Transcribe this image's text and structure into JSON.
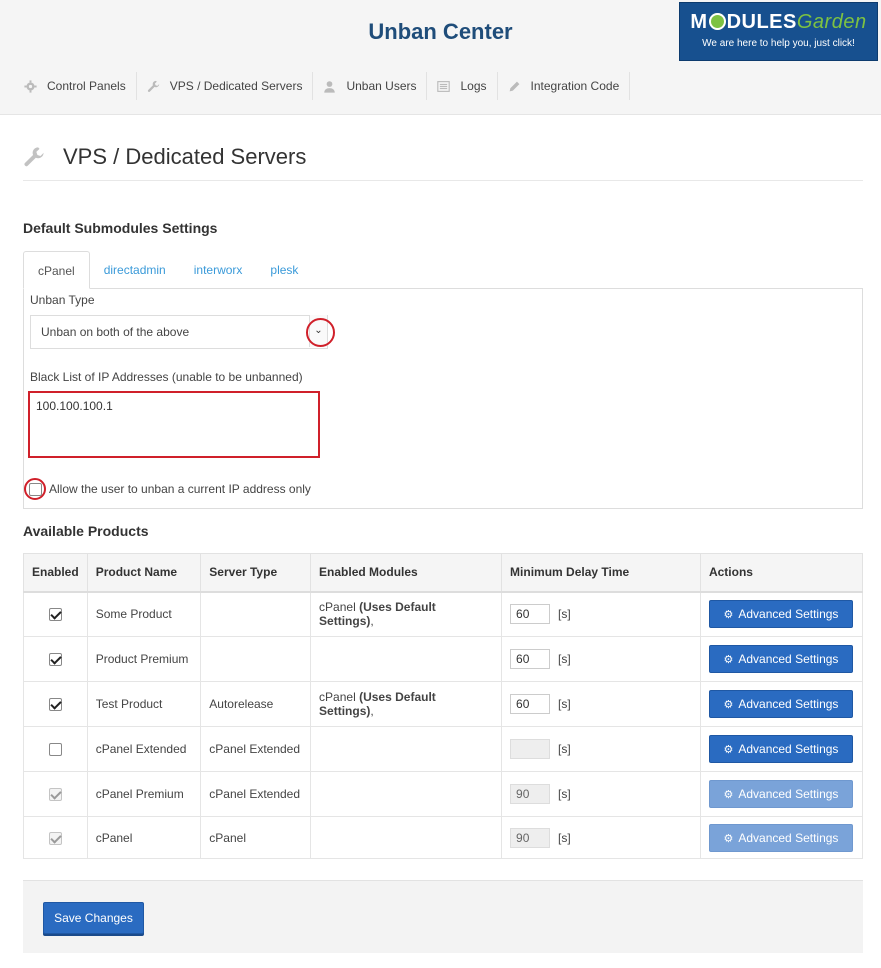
{
  "header": {
    "app_title": "Unban Center",
    "brand_name": "MODULES Garden",
    "brand_tagline": "We are here to help you, just click!"
  },
  "nav": [
    {
      "label": "Control Panels",
      "icon": "gear-icon"
    },
    {
      "label": "VPS / Dedicated Servers",
      "icon": "wrench-icon"
    },
    {
      "label": "Unban Users",
      "icon": "user-icon"
    },
    {
      "label": "Logs",
      "icon": "list-icon"
    },
    {
      "label": "Integration Code",
      "icon": "pencil-icon"
    }
  ],
  "page": {
    "title": "VPS / Dedicated Servers"
  },
  "defaults": {
    "section_title": "Default Submodules Settings",
    "tabs": [
      "cPanel",
      "directadmin",
      "interworx",
      "plesk"
    ],
    "active_tab": "cPanel",
    "unban_type_label": "Unban Type",
    "unban_type_value": "Unban on both of the above",
    "blacklist_label": "Black List of IP Addresses (unable to be unbanned)",
    "blacklist_value": "100.100.100.1",
    "allow_current_ip_label": "Allow the user to unban a current IP address only",
    "allow_current_ip_checked": false
  },
  "products": {
    "section_title": "Available Products",
    "columns": [
      "Enabled",
      "Product Name",
      "Server Type",
      "Enabled Modules",
      "Minimum Delay Time",
      "Actions"
    ],
    "unit": "[s]",
    "action_label": "Advanced Settings",
    "rows": [
      {
        "enabled": true,
        "disabled": false,
        "name": "Some Product",
        "server_type": "",
        "module": "cPanel",
        "module_note": "(Uses Default Settings)",
        "module_suffix": ",",
        "delay": "60"
      },
      {
        "enabled": true,
        "disabled": false,
        "name": "Product Premium",
        "server_type": "",
        "module": "",
        "module_note": "",
        "module_suffix": "",
        "delay": "60"
      },
      {
        "enabled": true,
        "disabled": false,
        "name": "Test Product",
        "server_type": "Autorelease",
        "module": "cPanel",
        "module_note": "(Uses Default Settings)",
        "module_suffix": ",",
        "delay": "60"
      },
      {
        "enabled": false,
        "disabled": false,
        "name": "cPanel Extended",
        "server_type": "cPanel Extended",
        "module": "",
        "module_note": "",
        "module_suffix": "",
        "delay": ""
      },
      {
        "enabled": true,
        "disabled": true,
        "name": "cPanel Premium",
        "server_type": "cPanel Extended",
        "module": "",
        "module_note": "",
        "module_suffix": "",
        "delay": "90"
      },
      {
        "enabled": true,
        "disabled": true,
        "name": "cPanel",
        "server_type": "cPanel",
        "module": "",
        "module_note": "",
        "module_suffix": "",
        "delay": "90"
      }
    ]
  },
  "footer": {
    "save_label": "Save Changes"
  },
  "colors": {
    "title": "#1f4d7a",
    "primary_button": "#2a6bc1",
    "link": "#3a9ad9",
    "highlight": "#d0202a",
    "brand_bg": "#17508f"
  }
}
